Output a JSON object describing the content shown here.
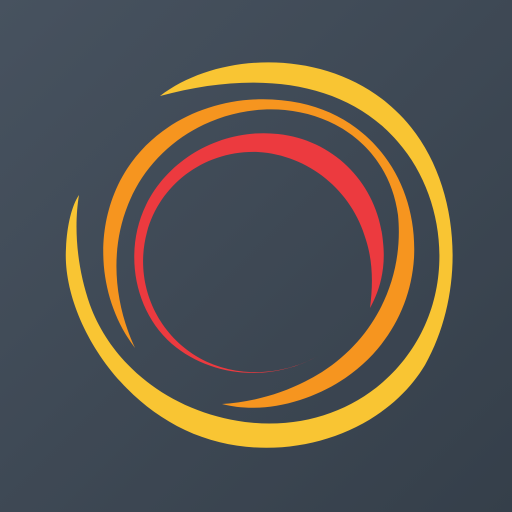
{
  "icon": {
    "name": "concentric-swirl-rings-icon",
    "colors": {
      "background_top": "#47525f",
      "background_bottom": "#353f4a",
      "outer_ring": "#f9c533",
      "middle_ring": "#f6951f",
      "inner_ring": "#ec3a3f"
    }
  }
}
